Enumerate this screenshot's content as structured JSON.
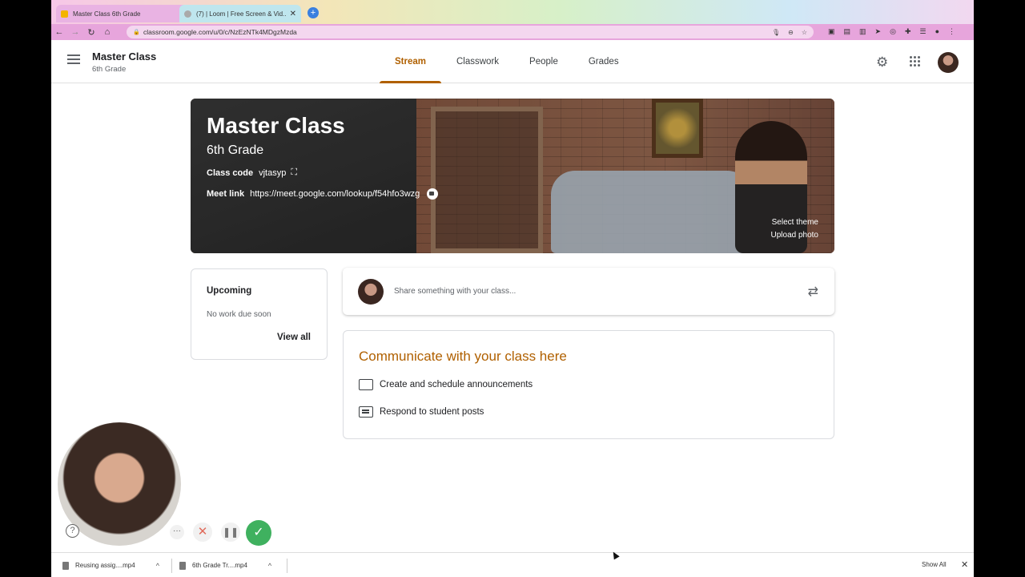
{
  "browser": {
    "tabs": [
      {
        "title": "Master Class 6th Grade",
        "active": true,
        "favicon_color": "#f4b400"
      },
      {
        "title": "(7) | Loom | Free Screen & Vid...",
        "active": false,
        "favicon_color": "#888888"
      }
    ],
    "new_tab_icon": "+",
    "url": "classroom.google.com/u/0/c/NzEzNTk4MDgzMzda"
  },
  "header": {
    "class_name": "Master Class",
    "section": "6th Grade",
    "tabs": [
      {
        "label": "Stream",
        "active": true
      },
      {
        "label": "Classwork",
        "active": false
      },
      {
        "label": "People",
        "active": false
      },
      {
        "label": "Grades",
        "active": false
      }
    ]
  },
  "banner": {
    "title": "Master Class",
    "subtitle": "6th Grade",
    "class_code_label": "Class code",
    "class_code": "vjtasyp",
    "meet_label": "Meet link",
    "meet_url": "https://meet.google.com/lookup/f54hfo3wzg",
    "select_theme": "Select theme",
    "upload_photo": "Upload photo"
  },
  "upcoming": {
    "title": "Upcoming",
    "empty": "No work due soon",
    "view_all": "View all"
  },
  "share": {
    "placeholder": "Share something with your class..."
  },
  "communicate": {
    "title": "Communicate with your class here",
    "items": [
      "Create and schedule announcements",
      "Respond to student posts"
    ]
  },
  "downloads": {
    "items": [
      "Reusing assig....mp4",
      "6th Grade Tr....mp4"
    ],
    "show_all": "Show All"
  },
  "colors": {
    "accent": "#b06000",
    "loom_green": "#3fb15f"
  }
}
